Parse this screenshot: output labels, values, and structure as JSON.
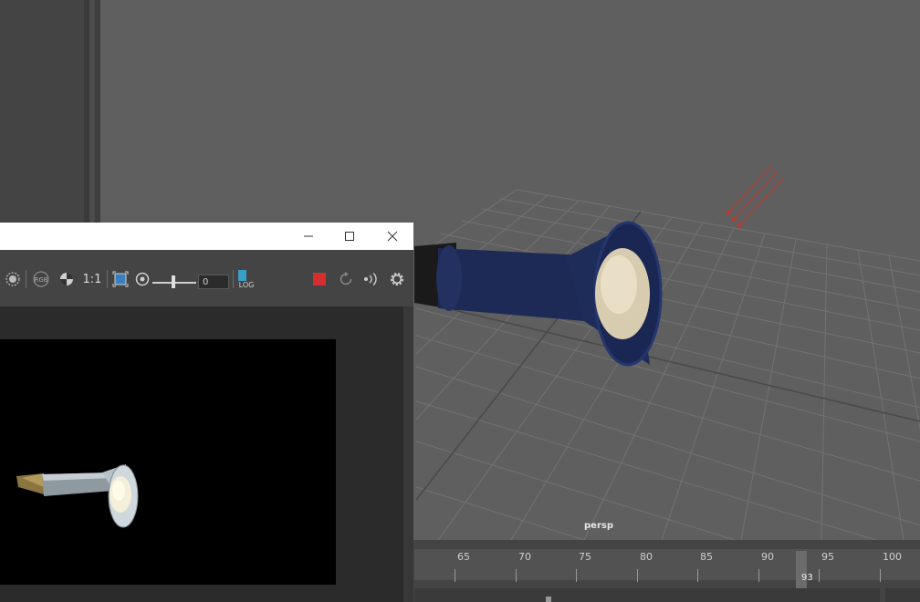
{
  "viewport": {
    "camera_label": "persp"
  },
  "render_view": {
    "toolbar": {
      "ratio_label": "1:1",
      "exposure_value": "0",
      "log_label": "LOG",
      "rgb_label": "RGB"
    },
    "titlebar": {
      "minimize_icon": "minimize-icon",
      "maximize_icon": "maximize-icon",
      "close_icon": "close-icon"
    }
  },
  "timeline": {
    "ticks": [
      "65",
      "70",
      "75",
      "80",
      "85",
      "90",
      "95",
      "100"
    ],
    "current_frame": "93"
  },
  "colors": {
    "viewport_bg": "#5f5f5f",
    "grid": "#707070",
    "flashlight_body": "#1e2b55",
    "record_button": "#d32f2f",
    "directional_light": "#c0392b"
  }
}
